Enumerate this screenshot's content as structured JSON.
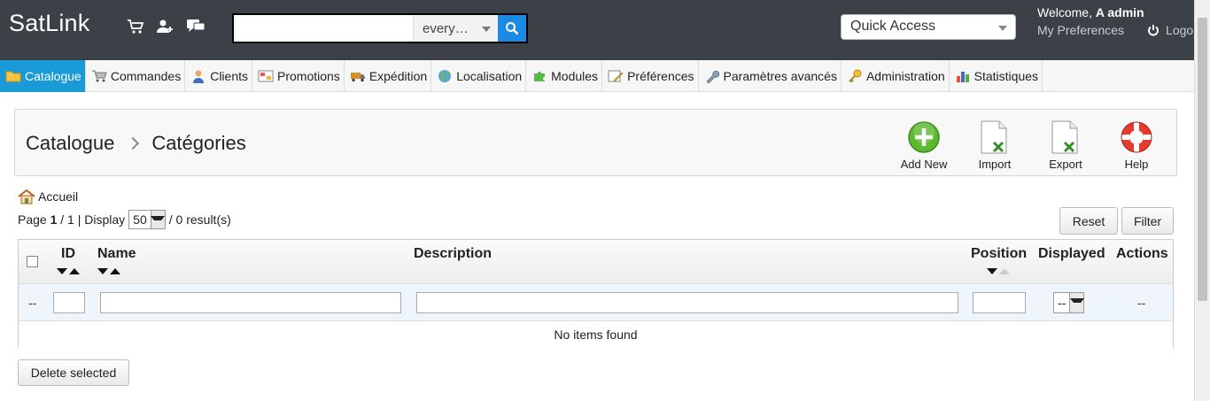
{
  "header": {
    "brand": "SatLink",
    "search": {
      "value": "",
      "placeholder": "",
      "scope": "every…"
    },
    "quick_access": "Quick Access",
    "welcome_prefix": "Welcome,",
    "user_name": "A admin",
    "my_preferences": "My Preferences",
    "logout": "Logo"
  },
  "nav": {
    "tabs": [
      {
        "label": "Catalogue",
        "icon": "folder-icon",
        "active": true
      },
      {
        "label": "Commandes",
        "icon": "cart-icon"
      },
      {
        "label": "Clients",
        "icon": "user-icon"
      },
      {
        "label": "Promotions",
        "icon": "promo-icon"
      },
      {
        "label": "Expédition",
        "icon": "truck-icon"
      },
      {
        "label": "Localisation",
        "icon": "globe-icon"
      },
      {
        "label": "Modules",
        "icon": "puzzle-icon"
      },
      {
        "label": "Préférences",
        "icon": "preferences-icon"
      },
      {
        "label": "Paramètres avancés",
        "icon": "wrench-icon"
      },
      {
        "label": "Administration",
        "icon": "key-icon"
      },
      {
        "label": "Statistiques",
        "icon": "stats-icon"
      }
    ]
  },
  "page": {
    "breadcrumb_parent": "Catalogue",
    "breadcrumb_current": "Catégories",
    "actions": {
      "add_new": "Add New",
      "import": "Import",
      "export": "Export",
      "help": "Help"
    },
    "home_label": "Accueil",
    "pager": {
      "page_label": "Page",
      "current_page": "1",
      "total_pages": "/ 1 | Display",
      "per_page": "50",
      "results": "/ 0 result(s)"
    },
    "reset": "Reset",
    "filter": "Filter",
    "delete_selected": "Delete selected"
  },
  "table": {
    "columns": {
      "id": "ID",
      "name": "Name",
      "description": "Description",
      "position": "Position",
      "displayed": "Displayed",
      "actions": "Actions"
    },
    "filter_row": {
      "checkbox_placeholder": "--",
      "displayed_value": "--",
      "actions_placeholder": "--"
    },
    "empty_message": "No items found"
  },
  "colors": {
    "header_bg": "#3c4148",
    "active_tab": "#1a9ad6",
    "search_button": "#1a8ae5",
    "add_new_green": "#5cb82e"
  }
}
